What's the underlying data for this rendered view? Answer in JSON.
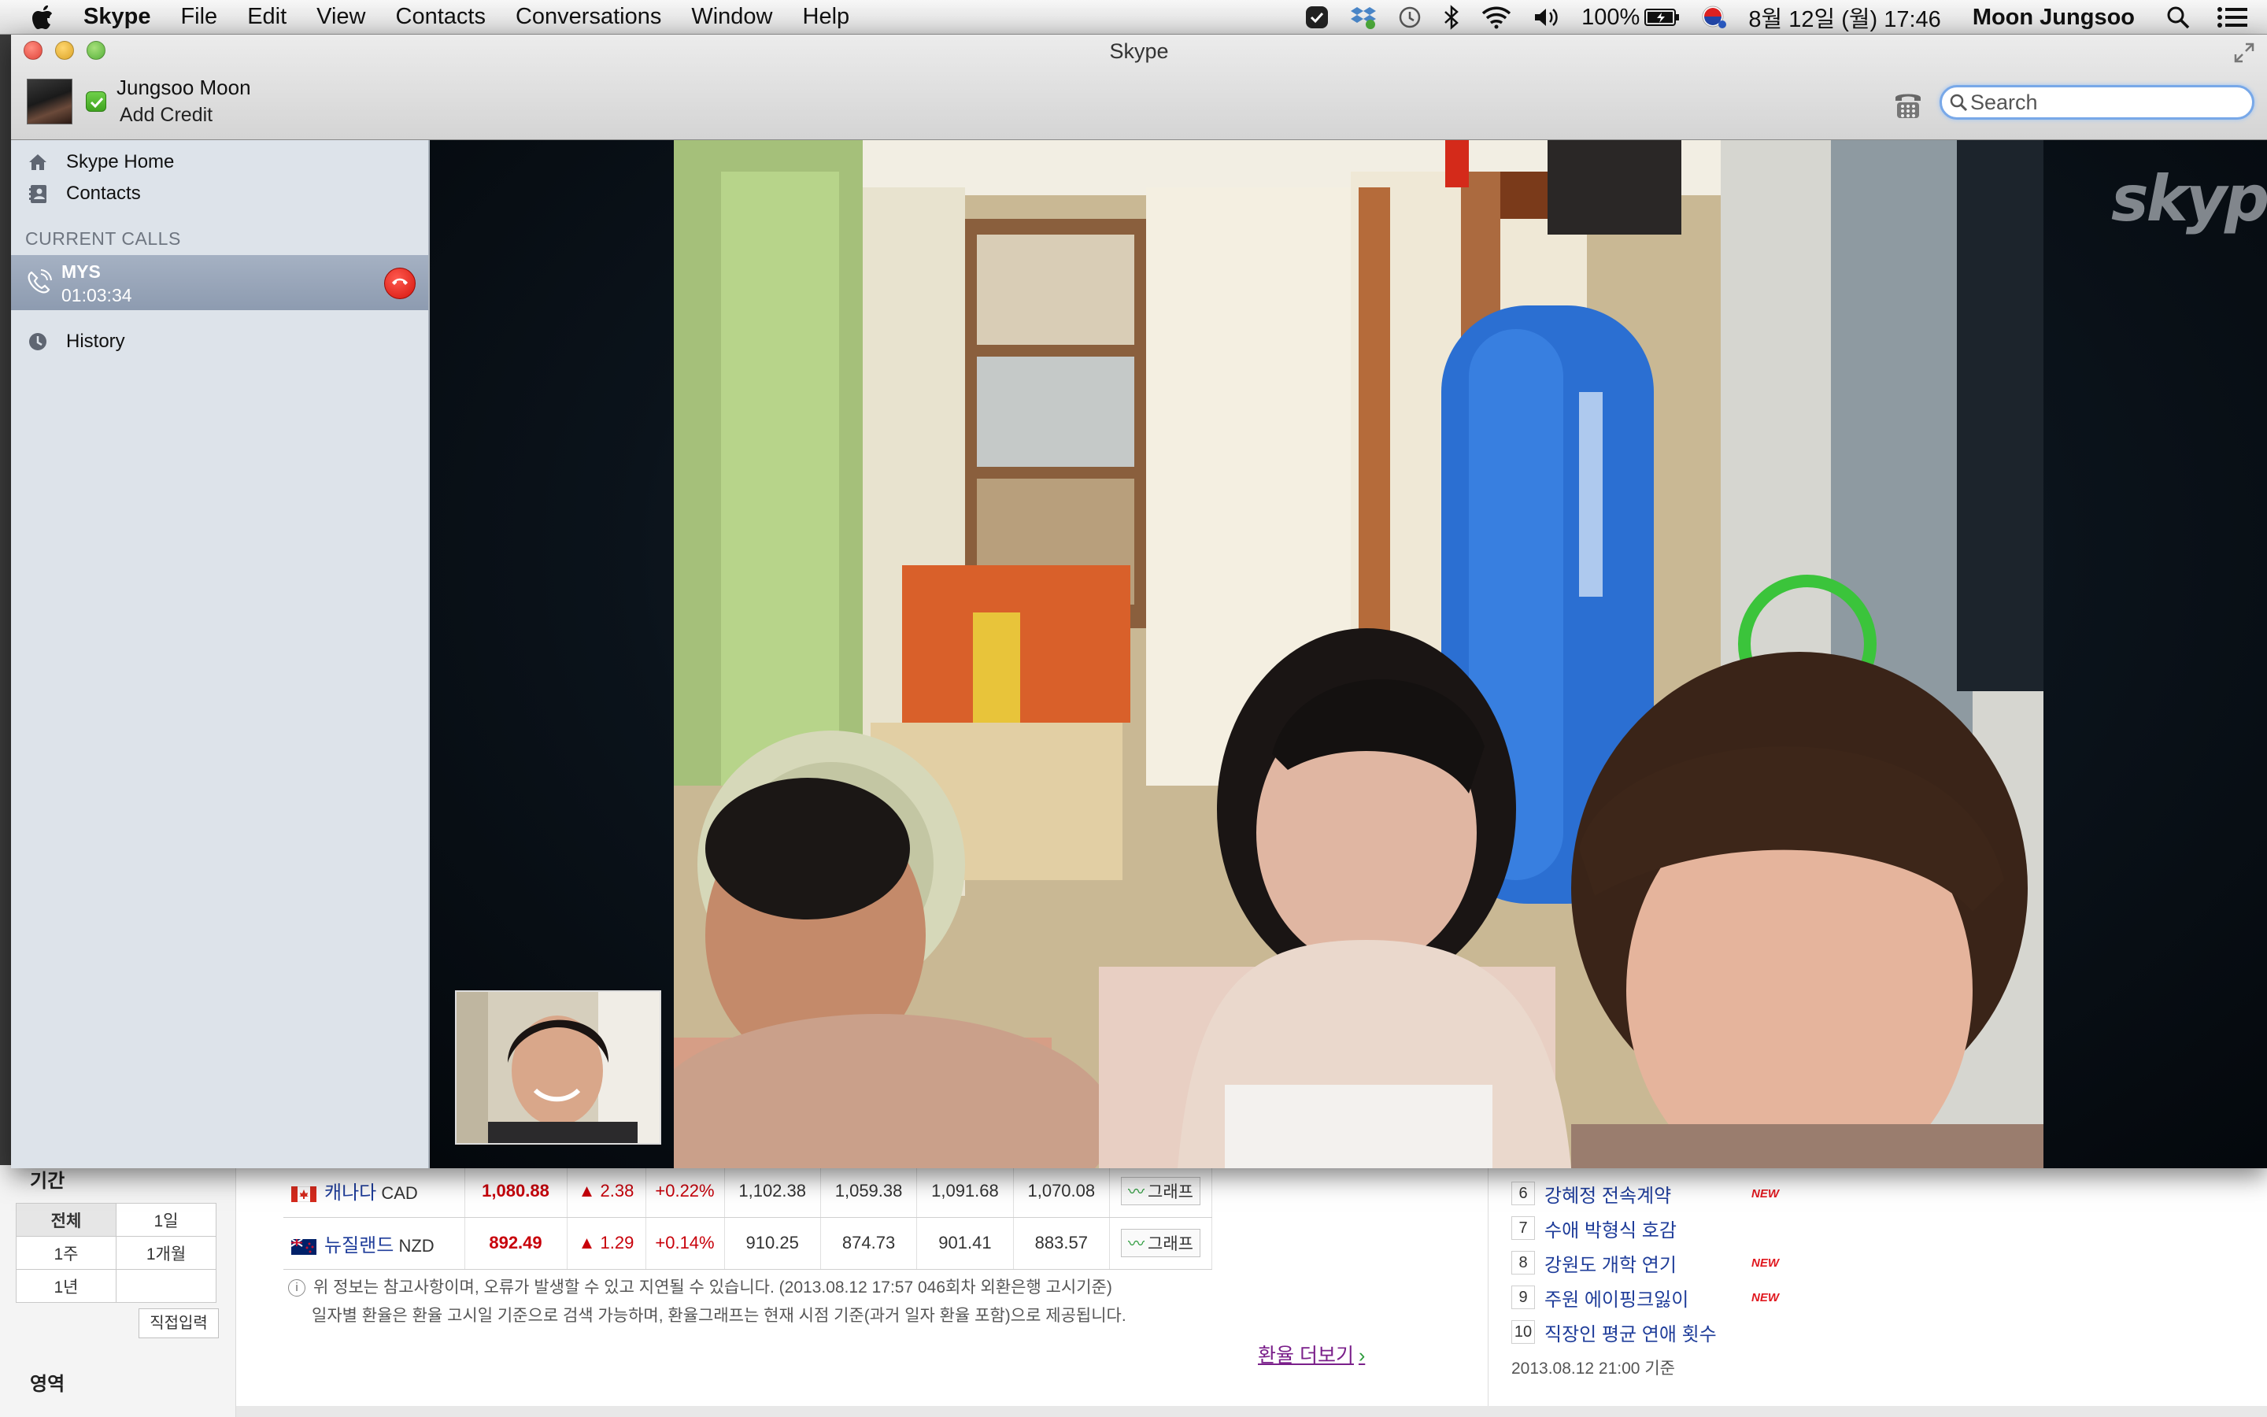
{
  "menubar": {
    "app_name": "Skype",
    "menus": [
      "File",
      "Edit",
      "View",
      "Contacts",
      "Conversations",
      "Window",
      "Help"
    ],
    "battery": "100%",
    "datetime": "8월 12일 (월)  17:46",
    "user": "Moon Jungsoo",
    "status_icons": [
      "skype-status-icon",
      "dropbox-icon",
      "time-machine-icon",
      "bluetooth-icon",
      "wifi-icon",
      "volume-icon",
      "battery-icon",
      "input-source-flag-icon",
      "spotlight-icon",
      "notification-center-icon"
    ]
  },
  "window": {
    "title": "Skype"
  },
  "profile": {
    "name": "Jungsoo Moon",
    "add_credit": "Add Credit",
    "status": "online"
  },
  "search": {
    "placeholder": "Search",
    "value": ""
  },
  "sidebar": {
    "home_label": "Skype Home",
    "contacts_label": "Contacts",
    "current_calls_title": "CURRENT CALLS",
    "call": {
      "name": "MYS",
      "duration": "01:03:34"
    },
    "history_label": "History"
  },
  "video": {
    "watermark": "skype"
  },
  "background_page": {
    "period_title": "기간",
    "period_options": [
      [
        "전체",
        "1일"
      ],
      [
        "1주",
        "1개월"
      ],
      [
        "1년",
        ""
      ]
    ],
    "direct_input": "직접입력",
    "area_title": "영역",
    "rates": [
      {
        "country": "캐나다",
        "code": "CAD",
        "price": "1,080.88",
        "change": "▲ 2.38",
        "pct": "+0.22%",
        "c1": "1,102.38",
        "c2": "1,059.38",
        "c3": "1,091.68",
        "c4": "1,070.08",
        "graph": "그래프"
      },
      {
        "country": "뉴질랜드",
        "code": "NZD",
        "price": "892.49",
        "change": "▲ 1.29",
        "pct": "+0.14%",
        "c1": "910.25",
        "c2": "874.73",
        "c3": "901.41",
        "c4": "883.57",
        "graph": "그래프"
      }
    ],
    "note_line1": "위 정보는 참고사항이며, 오류가 발생할 수 있고 지연될 수 있습니다. (2013.08.12 17:57 046회차 외환은행 고시기준)",
    "note_line2": "일자별 환율은 환율 고시일 기준으로 검색 가능하며, 환율그래프는 현재 시점 기준(과거 일자 환율 포함)으로 제공됩니다.",
    "more_rates": "환율 더보기",
    "ranking": [
      {
        "rank": "6",
        "text": "강혜정 전속계약",
        "new": "NEW"
      },
      {
        "rank": "7",
        "text": "수애 박형식 호감",
        "new": ""
      },
      {
        "rank": "8",
        "text": "강원도 개학 연기",
        "new": "NEW"
      },
      {
        "rank": "9",
        "text": "주원 에이핑크잃이",
        "new": "NEW"
      },
      {
        "rank": "10",
        "text": "직장인 평균 연애 횟수",
        "new": ""
      }
    ],
    "ranking_date": "2013.08.12 21:00 기준"
  }
}
